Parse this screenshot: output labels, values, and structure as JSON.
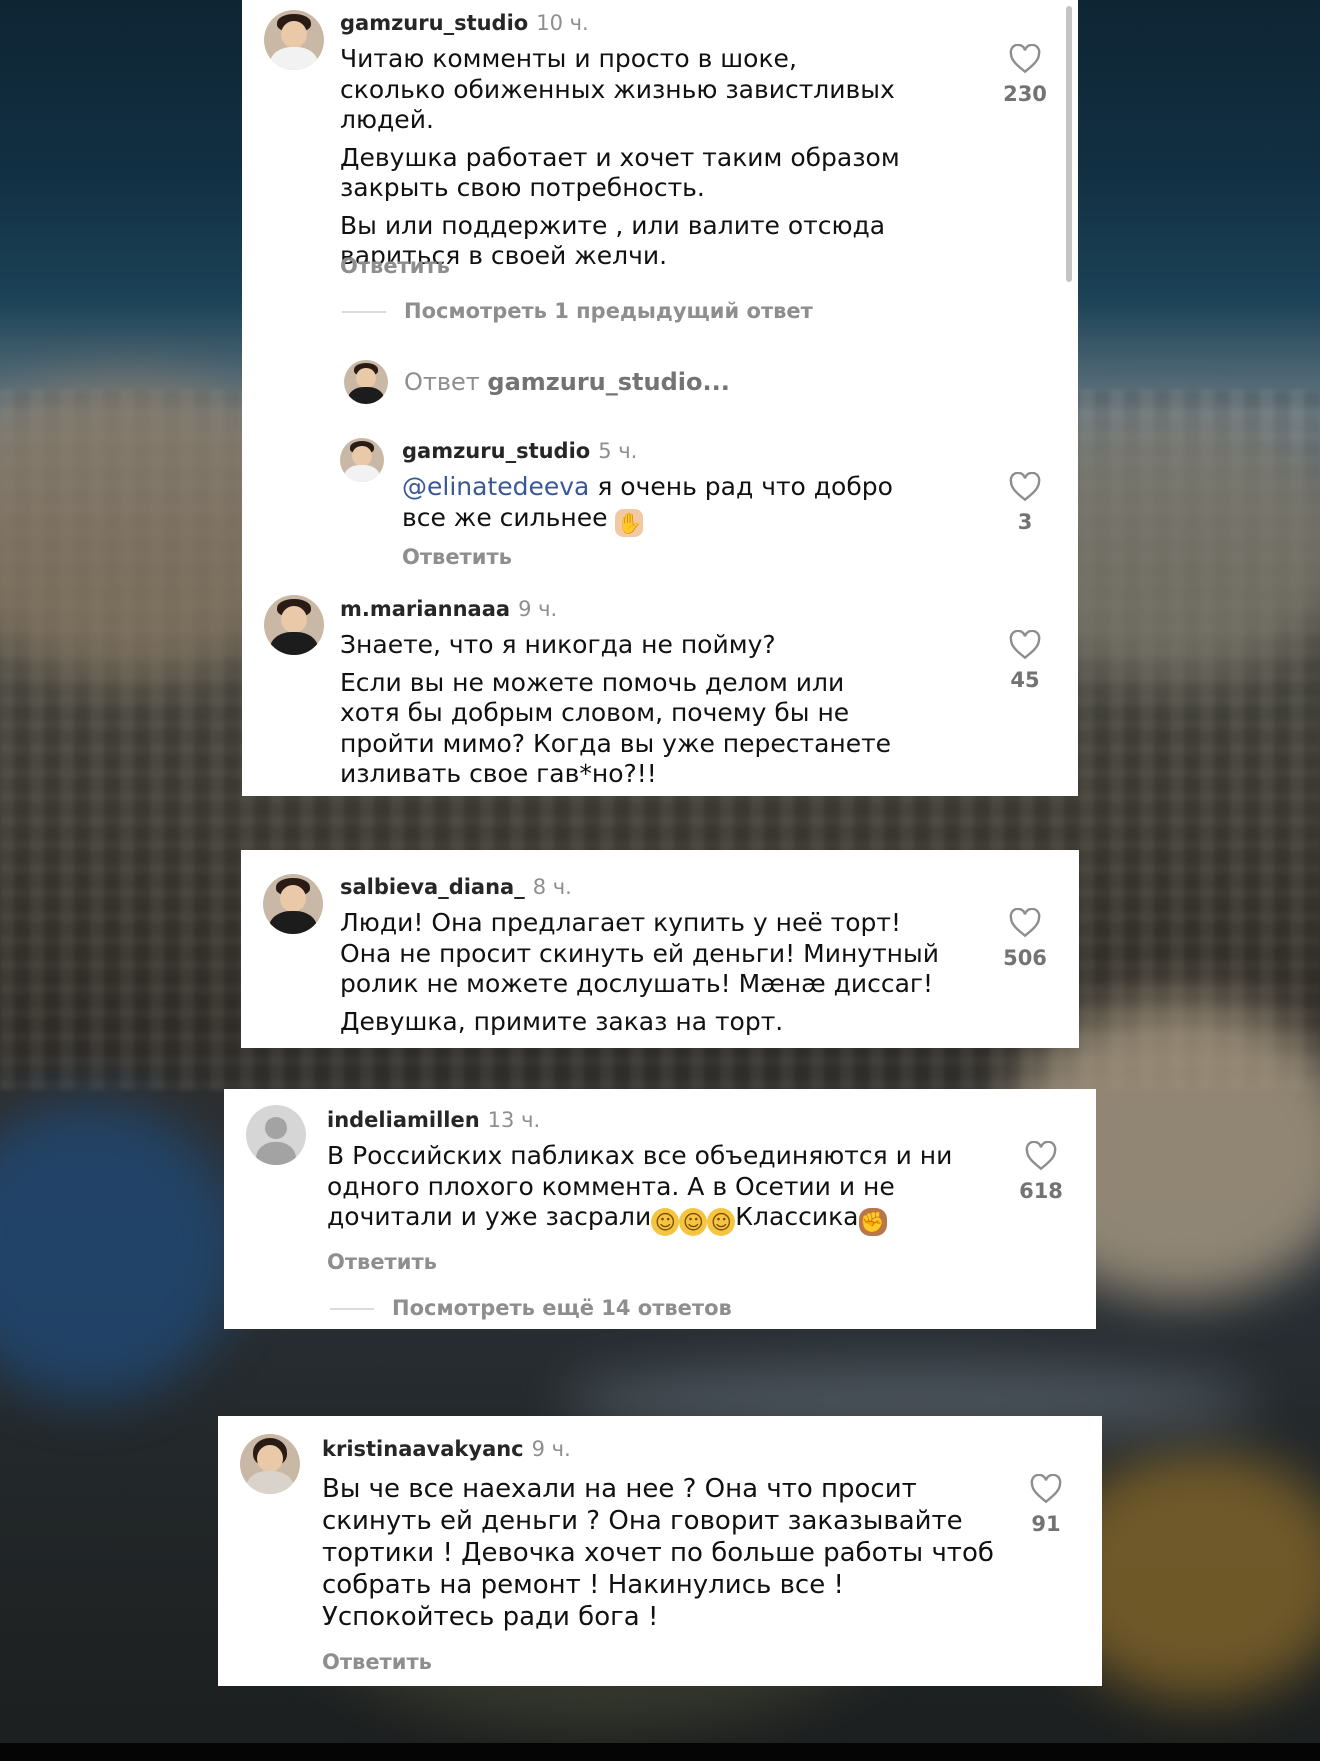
{
  "reply_label": "Ответить",
  "card1": {
    "main": {
      "username": "gamzuru_studio",
      "time": "10 ч.",
      "paragraphs": [
        "Читаю комменты и просто в шоке, сколько обиженных жизнью завистливых людей.",
        "Девушка работает и хочет таким образом закрыть свою потребность.",
        "Вы или поддержите , или валите отсюда вариться в своей желчи."
      ],
      "likes": "230",
      "reply": "Ответить"
    },
    "view_previous": "Посмотреть 1 предыдущий ответ",
    "reply_to_prefix": "Ответ",
    "reply_to_user": "gamzuru_studio...",
    "nested": {
      "username": "gamzuru_studio",
      "time": "5 ч.",
      "mention": "@elinatedeeva",
      "text": " я очень рад что добро все же сильнее",
      "likes": "3",
      "reply": "Ответить"
    },
    "second": {
      "username": "m.mariannaaa",
      "time": "9 ч.",
      "paragraphs": [
        "Знаете, что я никогда не пойму?",
        "Если вы не можете помочь делом или хотя бы добрым словом, почему бы не пройти мимо? Когда вы уже перестанете изливать свое гав*но?!!"
      ],
      "likes": "45"
    }
  },
  "card2": {
    "username": "salbieva_diana_",
    "time": "8 ч.",
    "paragraphs": [
      "Люди! Она предлагает купить у неё торт! Она не просит скинуть ей деньги! Минутный ролик не можете дослушать! Мæнæ диссаг!",
      "Девушка, примите заказ на торт."
    ],
    "likes": "506"
  },
  "card3": {
    "username": "indeliamillen",
    "time": "13 ч.",
    "text": "В Российских пабликах все объединяются и ни одного плохого коммента. А в Осетии и не дочитали и уже засрали",
    "text_end": "Классика",
    "likes": "618",
    "reply": "Ответить",
    "view_more": "Посмотреть ещё 14 ответов"
  },
  "card4": {
    "username": "kristinaavakyanc",
    "time": "9 ч.",
    "text": "Вы че все наехали на нее ? Она что просит скинуть ей деньги ? Она говорит заказывайте тортики ! Девочка хочет по больше работы чтоб собрать на ремонт ! Накинулись все ! Успокойтесь ради бога !",
    "likes": "91",
    "reply": "Ответить"
  },
  "icons": {
    "like": "heart-outline-icon",
    "laugh": "face-with-tears-of-joy-emoji",
    "fist": "raised-fist-emoji",
    "pray": "folded-hands-emoji"
  }
}
